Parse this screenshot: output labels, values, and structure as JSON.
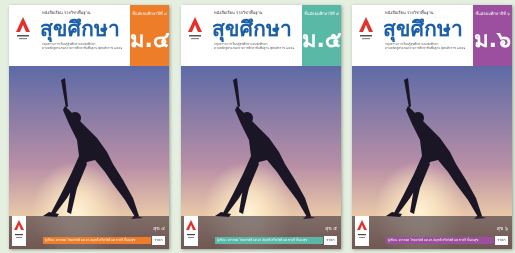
{
  "books": [
    {
      "series": "หนังสือเรียน รายวิชาพื้นฐาน",
      "title": "สุขศึกษา",
      "subtitle_lines": [
        "กลุ่มสาระการเรียนรู้สุขศึกษาและพลศึกษา",
        "ตามหลักสูตรแกนกลางการศึกษาขั้นพื้นฐาน พุทธศักราช ๒๕๕๑"
      ],
      "grade_tag": "ชั้นมัธยมศึกษาปีที่ ๔",
      "grade": "ม.๔",
      "grade_color": "#ee7d2a",
      "footer_text": "ผู้เขียน: อรรถพล โชคสวัสดิ์ ผศ.ดร.อัญชลี ศรีสวัสดิ์ ผศ.ชาตรี ปั้นคงสุข",
      "footer_color": "#ee7d2a",
      "footer_tag": "ราคา",
      "publisher_mark": "สุข ๔"
    },
    {
      "series": "หนังสือเรียน รายวิชาพื้นฐาน",
      "title": "สุขศึกษา",
      "subtitle_lines": [
        "กลุ่มสาระการเรียนรู้สุขศึกษาและพลศึกษา",
        "ตามหลักสูตรแกนกลางการศึกษาขั้นพื้นฐาน พุทธศักราช ๒๕๕๑"
      ],
      "grade_tag": "ชั้นมัธยมศึกษาปีที่ ๕",
      "grade": "ม.๕",
      "grade_color": "#5ab8a6",
      "footer_text": "ผู้เขียน: อรรถพล โชคสวัสดิ์ ผศ.ดร.อัญชลี ศรีสวัสดิ์ ผศ.ชาตรี ปั้นคงสุข",
      "footer_color": "#5ab8a6",
      "footer_tag": "ราคา",
      "publisher_mark": "สุข ๕"
    },
    {
      "series": "หนังสือเรียน รายวิชาพื้นฐาน",
      "title": "สุขศึกษา",
      "subtitle_lines": [
        "กลุ่มสาระการเรียนรู้สุขศึกษาและพลศึกษา",
        "ตามหลักสูตรแกนกลางการศึกษาขั้นพื้นฐาน พุทธศักราช ๒๕๕๑"
      ],
      "grade_tag": "ชั้นมัธยมศึกษาปีที่ ๖",
      "grade": "ม.๖",
      "grade_color": "#9b4f9e",
      "footer_text": "ผู้เขียน: อรรถพล โชคสวัสดิ์ ผศ.ดร.อัญชลี ศรีสวัสดิ์ ผศ.ชาตรี ปั้นคงสุข",
      "footer_color": "#9b4f9e",
      "footer_tag": "ราคา",
      "publisher_mark": "สุข ๖"
    }
  ],
  "colors": {
    "background": "#e4efe0",
    "title_blue": "#1a5fa8",
    "sky_top": "#5d6aa6",
    "sky_mid": "#b98fa6",
    "sky_sun": "#fff4d8",
    "logo_red": "#e2312b"
  }
}
